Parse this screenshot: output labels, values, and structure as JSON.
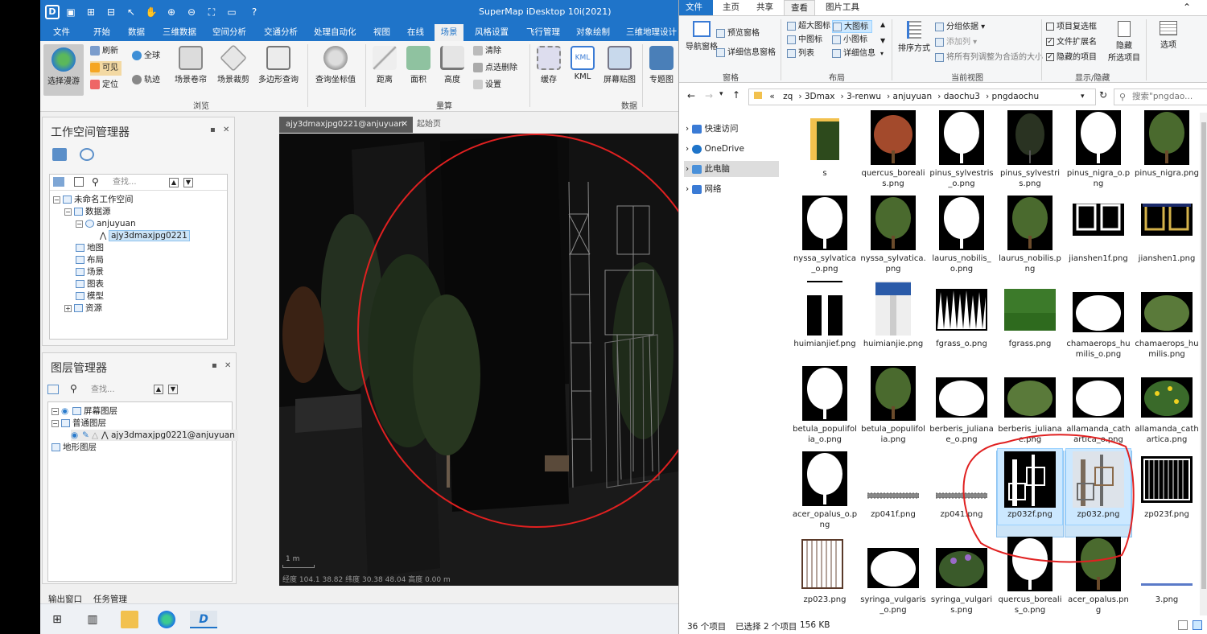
{
  "supermap": {
    "window_title": "SuperMap iDesktop 10i(2021)",
    "tabs": [
      "文件",
      "开始",
      "数据",
      "三维数据",
      "空间分析",
      "交通分析",
      "处理自动化",
      "视图",
      "在线",
      "场景",
      "风格设置",
      "飞行管理",
      "对象绘制",
      "三维地理设计"
    ],
    "active_tab": "场景",
    "ribbon": {
      "select_roam": "选择漫游",
      "refresh": "刷新",
      "visible": "可见",
      "locate": "定位",
      "global": "全球",
      "track": "轨迹",
      "scene_shutter": "场景卷帘",
      "scene_clip": "场景裁剪",
      "polygon_query": "多边形查询",
      "query_coords": "查询坐标值",
      "distance": "距离",
      "area": "面积",
      "height": "高度",
      "clear": "清除",
      "point_delete": "点选删除",
      "settings": "设置",
      "cache": "缓存",
      "kml": "KML",
      "screenshot": "屏幕贴图",
      "thematic": "专题图",
      "group_browse": "浏览",
      "group_measure": "量算",
      "group_data": "数据"
    },
    "workspace_panel": {
      "title": "工作空间管理器",
      "search_placeholder": "查找...",
      "nodes": {
        "workspace": "未命名工作空间",
        "datasources": "数据源",
        "datasource": "anjuyuan",
        "dataset": "ajy3dmaxjpg0221",
        "maps": "地图",
        "layouts": "布局",
        "scenes": "场景",
        "charts": "图表",
        "models": "模型",
        "resources": "资源"
      }
    },
    "layer_panel": {
      "title": "图层管理器",
      "search_placeholder": "查找...",
      "nodes": {
        "screen_layer": "屏幕图层",
        "normal_layer": "普通图层",
        "layer_item": "ajy3dmaxjpg0221@anjuyuan",
        "terrain_layer": "地形图层"
      }
    },
    "viewport": {
      "tab_label": "ajy3dmaxjpg0221@anjuyuan",
      "start_tab": "起始页",
      "scale": "1 m",
      "status": "经度 104.1  38.82  纬度 30.38  48.04  高度 0.00 m"
    },
    "bottom": {
      "output": "输出窗口",
      "tasks": "任务管理"
    }
  },
  "explorer": {
    "tabs": [
      "文件",
      "主页",
      "共享",
      "查看",
      "图片工具"
    ],
    "active_tab": "查看",
    "ribbon": {
      "nav_pane": "导航窗格",
      "preview_pane": "预览窗格",
      "details_pane": "详细信息窗格",
      "xl_icons": "超大图标",
      "large_icons": "大图标",
      "medium_icons": "中图标",
      "small_icons": "小图标",
      "list": "列表",
      "details": "详细信息",
      "sort_by": "排序方式",
      "group_by": "分组依据",
      "add_column": "添加列",
      "fit_columns": "将所有列调整为合适的大小",
      "checkboxes": "项目复选框",
      "extensions": "文件扩展名",
      "hidden_items": "隐藏的项目",
      "hide": "隐藏",
      "selected_items": "所选项目",
      "options": "选项",
      "group_pane": "窗格",
      "group_layout": "布局",
      "group_current_view": "当前视图",
      "group_show_hide": "显示/隐藏"
    },
    "address": [
      "«",
      "zq",
      "3Dmax",
      "3-renwu",
      "anjuyuan",
      "daochu3",
      "pngdaochu"
    ],
    "search_placeholder": "搜索\"pngdao...",
    "nav": [
      "快速访问",
      "OneDrive",
      "此电脑",
      "网络"
    ],
    "files": [
      {
        "name": "s",
        "kind": "folder"
      },
      {
        "name": "quercus_borealis.png",
        "kind": "tree-red"
      },
      {
        "name": "pinus_sylvestris_o.png",
        "kind": "tree-white"
      },
      {
        "name": "pinus_sylvestris.png",
        "kind": "tree-dark"
      },
      {
        "name": "pinus_nigra_o.png",
        "kind": "tree-white"
      },
      {
        "name": "pinus_nigra.png",
        "kind": "tree-green"
      },
      {
        "name": "nyssa_sylvatica_o.png",
        "kind": "tree-white"
      },
      {
        "name": "nyssa_sylvatica.png",
        "kind": "tree-green"
      },
      {
        "name": "laurus_nobilis_o.png",
        "kind": "tree-white"
      },
      {
        "name": "laurus_nobilis.png",
        "kind": "tree-green"
      },
      {
        "name": "jianshen1f.png",
        "kind": "frame-white"
      },
      {
        "name": "jianshen1.png",
        "kind": "frame-gold"
      },
      {
        "name": "huimianjief.png",
        "kind": "sign-white"
      },
      {
        "name": "huimianjie.png",
        "kind": "sign-blue"
      },
      {
        "name": "fgrass_o.png",
        "kind": "grass-white"
      },
      {
        "name": "fgrass.png",
        "kind": "grass-green"
      },
      {
        "name": "chamaerops_humilis_o.png",
        "kind": "bush-white"
      },
      {
        "name": "chamaerops_humilis.png",
        "kind": "bush-green"
      },
      {
        "name": "betula_populifolia_o.png",
        "kind": "tree-white"
      },
      {
        "name": "betula_populifolia.png",
        "kind": "tree-green"
      },
      {
        "name": "berberis_julianae_o.png",
        "kind": "bush-white"
      },
      {
        "name": "berberis_julianae.png",
        "kind": "bush-green"
      },
      {
        "name": "allamanda_cathartica_o.png",
        "kind": "bush-white"
      },
      {
        "name": "allamanda_cathartica.png",
        "kind": "bush-yellow"
      },
      {
        "name": "acer_opalus_o.png",
        "kind": "tree-white"
      },
      {
        "name": "zp041f.png",
        "kind": "strip"
      },
      {
        "name": "zp041.png",
        "kind": "strip"
      },
      {
        "name": "zp032f.png",
        "kind": "tower-white",
        "selected": true
      },
      {
        "name": "zp032.png",
        "kind": "tower-color",
        "selected": true
      },
      {
        "name": "zp023f.png",
        "kind": "gate-white"
      },
      {
        "name": "zp023.png",
        "kind": "gate-brown"
      },
      {
        "name": "syringa_vulgaris_o.png",
        "kind": "bush-white"
      },
      {
        "name": "syringa_vulgaris.png",
        "kind": "bush-purple"
      },
      {
        "name": "quercus_borealis_o.png",
        "kind": "tree-white"
      },
      {
        "name": "acer_opalus.png",
        "kind": "tree-green"
      },
      {
        "name": "3.png",
        "kind": "line"
      }
    ],
    "status": {
      "count": "36 个项目",
      "selected": "已选择 2 个项目",
      "size": "156 KB"
    }
  },
  "colors": {
    "accent": "#1f74c9",
    "annotation": "#e02020",
    "selection": "#cce8ff"
  }
}
